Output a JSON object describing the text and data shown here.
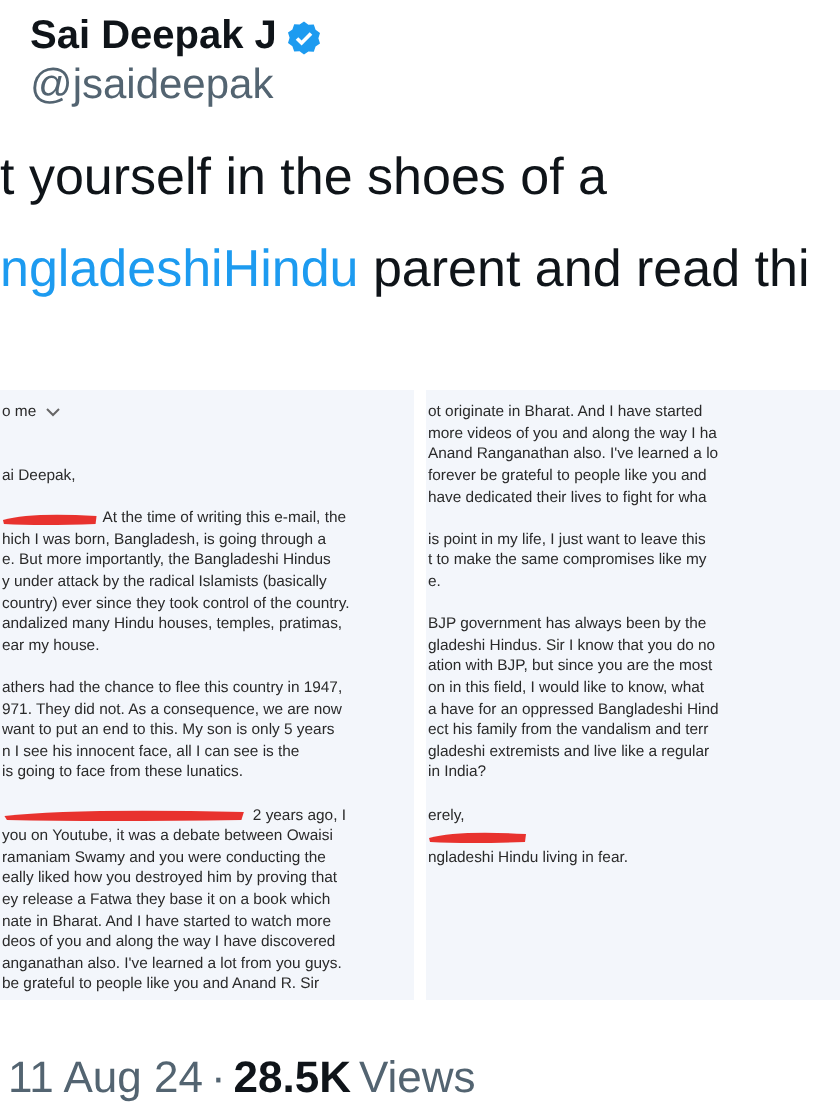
{
  "tweet": {
    "author": {
      "name": "Sai Deepak J",
      "handle": "@jsaideepak",
      "verified": true
    },
    "text_lines": [
      [
        {
          "kind": "plain",
          "text": "t yourself in the shoes of a"
        }
      ],
      [
        {
          "kind": "hashtag",
          "text": "ngladeshiHindu"
        },
        {
          "kind": "plain",
          "text": " parent and read thi"
        }
      ]
    ]
  },
  "attachment": {
    "panels": [
      {
        "lines": [
          {
            "kind": "recipient",
            "text": "o me"
          },
          {
            "kind": "gap"
          },
          {
            "kind": "gap"
          },
          {
            "kind": "line",
            "text": "ai Deepak,"
          },
          {
            "kind": "gap"
          },
          {
            "kind": "redacted",
            "text": "At the time of writing this e-mail, the"
          },
          {
            "kind": "line",
            "text": "hich I was born, Bangladesh, is going through a"
          },
          {
            "kind": "line",
            "text": "e. But more importantly, the Bangladeshi Hindus"
          },
          {
            "kind": "line",
            "text": "y under attack by the radical Islamists (basically"
          },
          {
            "kind": "line",
            "text": "country) ever since they took control of the country."
          },
          {
            "kind": "line",
            "text": "andalized many Hindu houses, temples, pratimas,"
          },
          {
            "kind": "line",
            "text": "ear my house."
          },
          {
            "kind": "gap"
          },
          {
            "kind": "line",
            "text": "athers had the chance to flee this country in 1947,"
          },
          {
            "kind": "line",
            "text": "971. They did not. As a consequence, we are now"
          },
          {
            "kind": "line",
            "text": "want to put an end to this. My son is only 5 years"
          },
          {
            "kind": "line",
            "text": "n I see his innocent face, all I can see is the"
          },
          {
            "kind": "line",
            "text": "is going to face from these lunatics."
          },
          {
            "kind": "gap"
          },
          {
            "kind": "redacted",
            "text": "2 years ago, I"
          },
          {
            "kind": "line",
            "text": "you on Youtube, it was a debate between Owaisi"
          },
          {
            "kind": "line",
            "text": "ramaniam Swamy and you were conducting the"
          },
          {
            "kind": "line",
            "text": "eally liked how you destroyed him by proving that"
          },
          {
            "kind": "line",
            "text": "ey release a Fatwa they base it on a book which"
          },
          {
            "kind": "line",
            "text": "nate in Bharat. And I have started to watch more"
          },
          {
            "kind": "line",
            "text": "deos of you and along the way I have discovered"
          },
          {
            "kind": "line",
            "text": "anganathan also. I've learned a lot from you guys."
          },
          {
            "kind": "line",
            "text": "be grateful to people like you and Anand R. Sir"
          }
        ]
      },
      {
        "lines": [
          {
            "kind": "line",
            "text": "ot originate in Bharat. And I have started"
          },
          {
            "kind": "line",
            "text": "more videos of you and along the way I ha"
          },
          {
            "kind": "line",
            "text": "Anand Ranganathan also. I've learned a lo"
          },
          {
            "kind": "line",
            "text": "forever be grateful to people like you and"
          },
          {
            "kind": "line",
            "text": "have dedicated their lives to fight for wha"
          },
          {
            "kind": "gap"
          },
          {
            "kind": "line",
            "text": "is point in my life, I just want to leave this"
          },
          {
            "kind": "line",
            "text": "t to make the same compromises like my"
          },
          {
            "kind": "line",
            "text": "e."
          },
          {
            "kind": "gap"
          },
          {
            "kind": "line",
            "text": "BJP government has always been by the"
          },
          {
            "kind": "line",
            "text": "gladeshi Hindus. Sir I know that you do no"
          },
          {
            "kind": "line",
            "text": "ation with BJP, but since you are the most"
          },
          {
            "kind": "line",
            "text": "on in this field, I would like to know, what"
          },
          {
            "kind": "line",
            "text": "a have for an oppressed Bangladeshi Hind"
          },
          {
            "kind": "line",
            "text": "ect his family from the vandalism and terr"
          },
          {
            "kind": "line",
            "text": "gladeshi extremists and live like a regular"
          },
          {
            "kind": "line",
            "text": "in India?"
          },
          {
            "kind": "gap"
          },
          {
            "kind": "line",
            "text": "erely,"
          },
          {
            "kind": "redacted"
          },
          {
            "kind": "line",
            "text": "ngladeshi Hindu living in fear."
          }
        ]
      }
    ]
  },
  "meta": {
    "date": "11 Aug 24",
    "separator": "·",
    "views_count": "28.5K",
    "views_label": "Views"
  }
}
